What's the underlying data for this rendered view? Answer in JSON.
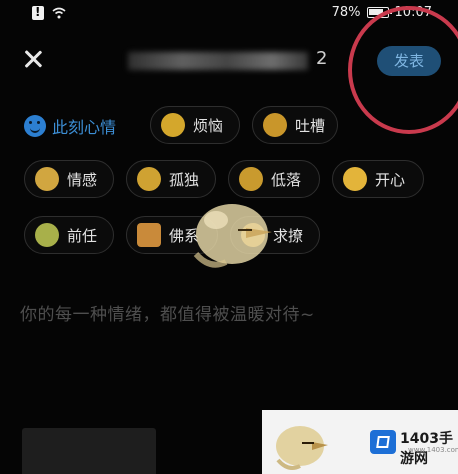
{
  "status_bar": {
    "battery": "78%",
    "time": "10:07"
  },
  "header": {
    "title_suffix": "2",
    "publish_label": "发表"
  },
  "mood": {
    "header_label": "此刻心情",
    "chips": [
      {
        "label": "烦恼",
        "icon": "annoyed-emoji",
        "color": "#d4a72c"
      },
      {
        "label": "吐槽",
        "icon": "complain-emoji",
        "color": "#c9962a"
      },
      {
        "label": "情感",
        "icon": "emotion-emoji",
        "color": "#d1a640"
      },
      {
        "label": "孤独",
        "icon": "lonely-emoji",
        "color": "#cfa232"
      },
      {
        "label": "低落",
        "icon": "down-emoji",
        "color": "#c99a2e"
      },
      {
        "label": "开心",
        "icon": "happy-emoji",
        "color": "#e3b43a"
      },
      {
        "label": "前任",
        "icon": "ex-emoji",
        "color": "#a8b04a"
      },
      {
        "label": "佛系",
        "icon": "zen-emoji",
        "color": "#c98a3a"
      },
      {
        "label": "求撩",
        "icon": "flirt-emoji",
        "color": "#d9a84a"
      }
    ]
  },
  "prompt": "你的每一种情绪，都值得被温暖对待~",
  "watermark": {
    "text": "1403手游网",
    "url": "www.1403.com"
  },
  "colors": {
    "accent": "#3d8fd6",
    "publish_bg": "#1f4f76",
    "highlight_circle": "#c93a4d"
  }
}
